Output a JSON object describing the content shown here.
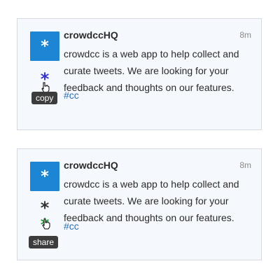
{
  "colors": {
    "avatar_bg": "#1d86d4",
    "hashtag": "#2a6fb5",
    "copy_star": "#3333cc",
    "share_star": "#1e9a2e",
    "tooltip_bg": "#3c3c3c"
  },
  "cards": [
    {
      "avatar_glyph": "*",
      "author": "crowdccHQ",
      "time": "8m",
      "text": "crowdcc is a web app to help collect and curate tweets. We are looking for your feedback and thoughts on our features.",
      "hashtag": "#cc",
      "actions": [
        {
          "icon": "asterisk-icon",
          "glyph": "*",
          "color": "#3333cc"
        }
      ],
      "tooltip": "copy"
    },
    {
      "avatar_glyph": "*",
      "author": "crowdccHQ",
      "time": "8m",
      "text": "crowdcc is a web app to help collect and curate tweets. We are looking for your feedback and thoughts on our features.",
      "hashtag": "#cc",
      "actions": [
        {
          "icon": "asterisk-icon",
          "glyph": "*",
          "color": "#333333"
        },
        {
          "icon": "asterisk-icon",
          "glyph": "*",
          "color": "#1e9a2e"
        }
      ],
      "tooltip": "share"
    }
  ]
}
